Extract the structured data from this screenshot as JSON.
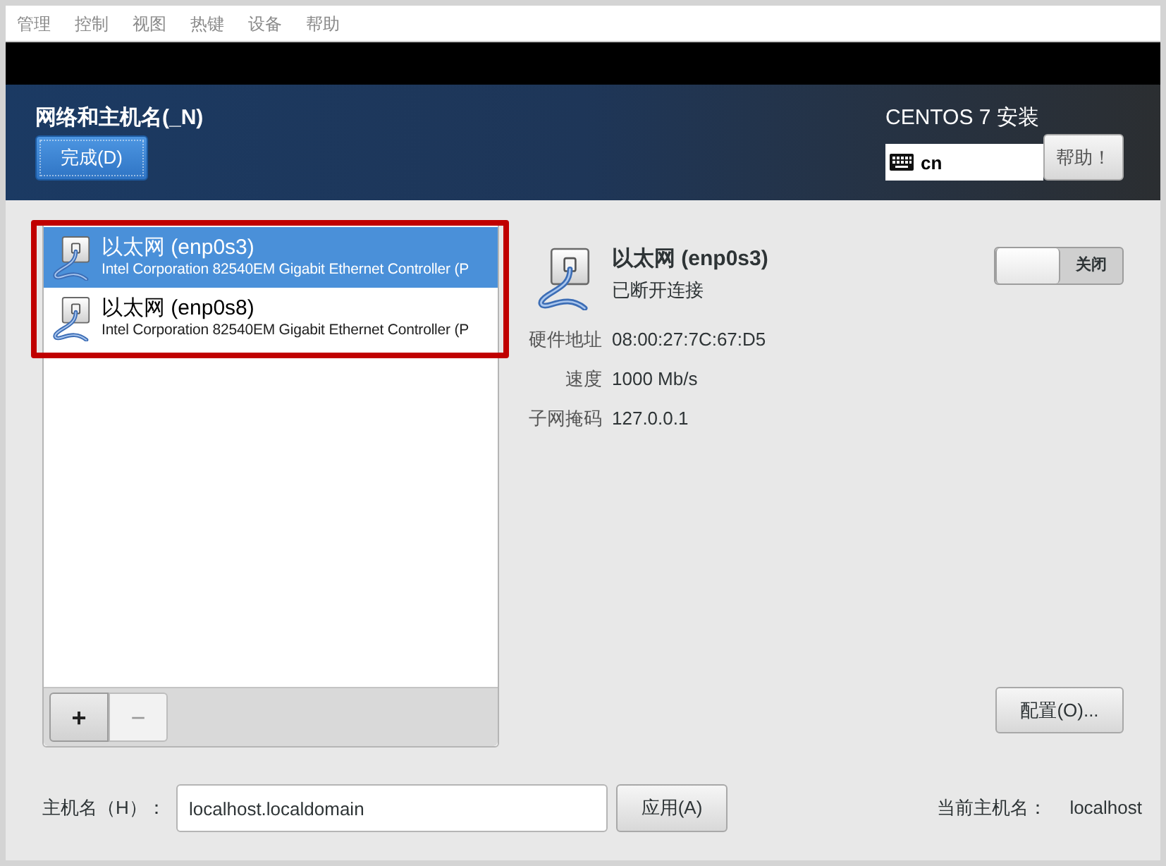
{
  "menu_bar": {
    "items": [
      "管理",
      "控制",
      "视图",
      "热键",
      "设备",
      "帮助"
    ]
  },
  "header": {
    "title": "网络和主机名(_N)",
    "done_button": "完成(D)",
    "product_title": "CENTOS 7 安装",
    "keyboard_layout": "cn",
    "help_button": "帮助！"
  },
  "connections": {
    "highlighted": true,
    "items": [
      {
        "name": "以太网 (enp0s3)",
        "description": "Intel Corporation 82540EM Gigabit Ethernet Controller (P",
        "selected": true
      },
      {
        "name": "以太网 (enp0s8)",
        "description": "Intel Corporation 82540EM Gigabit Ethernet Controller (P",
        "selected": false
      }
    ],
    "buttons": [
      {
        "label": "+",
        "disabled": false
      },
      {
        "label": "−",
        "disabled": true
      }
    ]
  },
  "details": {
    "name": "以太网 (enp0s3)",
    "status": "已断开连接",
    "switch": {
      "label": "关闭",
      "on": false
    },
    "properties": [
      {
        "label": "硬件地址",
        "value": "08:00:27:7C:67:D5"
      },
      {
        "label": "速度",
        "value": "1000 Mb/s"
      },
      {
        "label": "子网掩码",
        "value": "127.0.0.1"
      }
    ],
    "configure_button": "配置(O)..."
  },
  "hostname": {
    "label": "主机名（H）：",
    "value": "localhost.localdomain",
    "apply_button": "应用(A)",
    "current_label": "当前主机名：",
    "current_value": "localhost"
  }
}
